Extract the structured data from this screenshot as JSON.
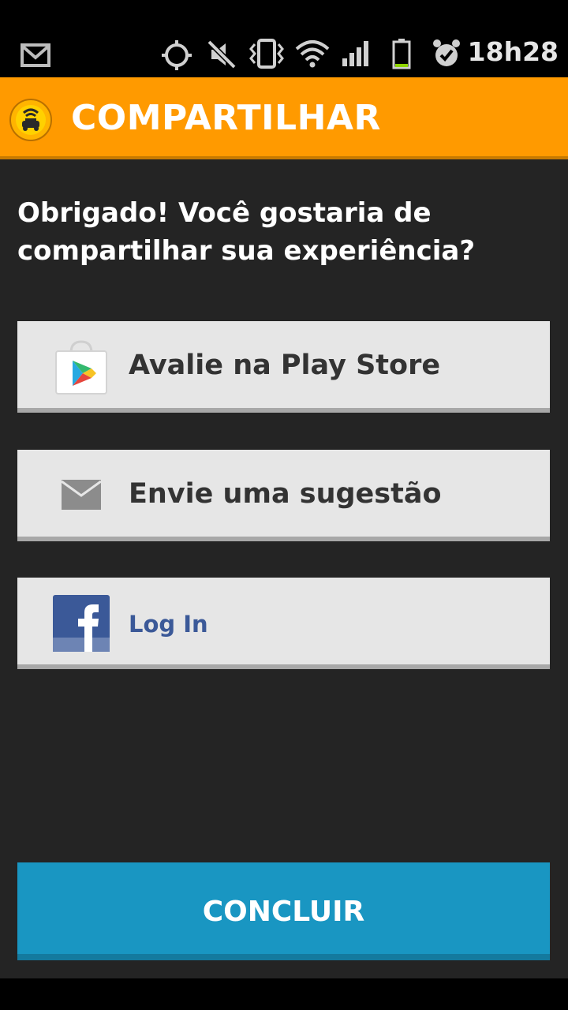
{
  "status_bar": {
    "time": "18h28",
    "icons": [
      "gmail-icon",
      "gps-icon",
      "mute-icon",
      "vibrate-icon",
      "wifi-icon",
      "signal-icon",
      "battery-icon",
      "alarm-icon"
    ]
  },
  "action_bar": {
    "title": "COMPARTILHAR",
    "logo_icon": "taxi-app-logo",
    "color": "#ff9a00"
  },
  "prompt": {
    "line1": "Obrigado! Você gostaria de",
    "line2": "compartilhar sua experiência?"
  },
  "options": [
    {
      "label": "Avalie na Play Store",
      "icon": "play-store-icon"
    },
    {
      "label": "Envie uma sugestão",
      "icon": "mail-icon"
    },
    {
      "label": "Log In",
      "icon": "facebook-icon"
    }
  ],
  "conclude": {
    "label": "CONCLUIR",
    "color": "#1996c2"
  }
}
